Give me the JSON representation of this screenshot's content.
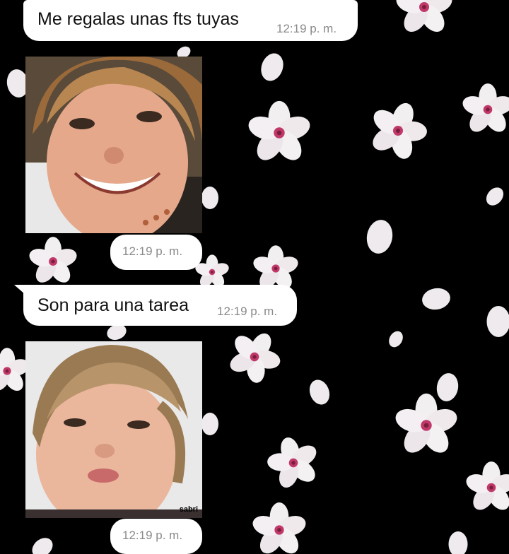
{
  "messages": [
    {
      "type": "text",
      "text": "Me regalas unas fts tuyas",
      "time": "12:19 p. m."
    },
    {
      "type": "image",
      "image": "child-photo-smiling",
      "time": "12:19 p. m."
    },
    {
      "type": "text",
      "text": "Son para una tarea",
      "time": "12:19 p. m."
    },
    {
      "type": "image",
      "image": "child-photo-closeup",
      "caption": "sabri",
      "time": "12:19 p. m."
    }
  ],
  "wallpaper": {
    "theme": "white-cherry-blossoms-on-black",
    "petal_color": "#f1eef0",
    "center_color": "#c0386a"
  }
}
